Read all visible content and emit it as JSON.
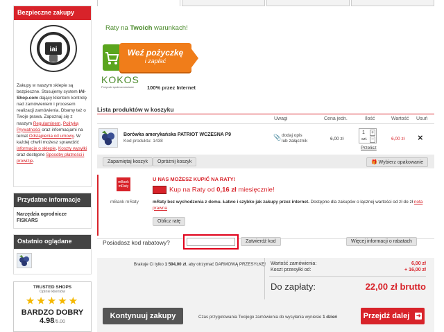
{
  "left": {
    "secure": {
      "heading": "Bezpieczne zakupy",
      "badge_ring": "POWERED BY IAI-Shop.com",
      "badge_logo": "iai",
      "text_1": "Zakupy w naszym sklepie są bezpieczne. Stosujemy system",
      "text_bold": "IAI-Shop.com",
      "text_2": "dający klientom kontrolę nad zamówieniem i procesem realizacji zamówienia. Dbamy też o Twoje prawa. Zapoznaj się z naszym",
      "link_regulations": "Regulaminem",
      "text_comma": ",",
      "link_privacy": "Polityką Prywatności",
      "text_3": "oraz informacjami na temat",
      "link_withdrawal": "Odstąpienia od umowy",
      "text_4": ". W każdej chwili możesz sprawdzić",
      "link_order_info": "informacje o sklepie",
      "text_5": ",",
      "link_shipping": "Koszty wysyłki",
      "text_6": "oraz dostępne",
      "link_payment": "Sposoby płatności i prowizje",
      "text_7": "."
    },
    "useful": {
      "heading": "Przydatne informacje",
      "line1": "Narzędzia ogrodnicze",
      "line2": "FISKARS"
    },
    "recent": {
      "heading": "Ostatnio oglądane"
    },
    "trusted": {
      "title": "TRUSTED SHOPS",
      "subtitle": "Opinie klientów",
      "rating_text": "BARDZO DOBRY",
      "score": "4.98",
      "score_max": "/5.00",
      "stars": 5
    }
  },
  "banner": {
    "tagline_1": "Raty na ",
    "tagline_bold": "Twoich",
    "tagline_2": " warunkach!",
    "button_line1": "Weź pożyczkę",
    "button_line2": "i zapłać",
    "brand": "KOKOS",
    "brand_sub": "Pożyczki społecznościowe",
    "internet": "100% przez Internet"
  },
  "cart": {
    "title": "Lista produktów w koszyku",
    "headers": {
      "notes": "Uwagi",
      "unit_price": "Cena jedn.",
      "quantity": "Ilość",
      "value": "Wartość",
      "remove": "Usuń"
    },
    "item": {
      "name": "Borówka amerykańska PATRIOT WCZESNA P9",
      "code_label": "Kod produktu:",
      "code": "1438",
      "note_line1": "dodaj opis",
      "note_line2": "lub załącznik",
      "price": "6,00 zł",
      "qty": "1",
      "unit": "szt.",
      "recalc": "Przelicz",
      "value": "6,00 zł",
      "remove": "×"
    },
    "btn_remember": "Zapamiętaj koszyk",
    "btn_clear": "Opróżnij koszyk",
    "btn_packaging": "Wybierz opakowanie"
  },
  "mbank": {
    "logo_top": "mBank",
    "logo_bottom": "mRaty",
    "label": "mBank mRaty",
    "title": "U NAS MOŻESZ KUPIĆ NA RATY!",
    "offer_1": "Kup na Raty od",
    "offer_amount": "0,16 zł",
    "offer_2": "miesięcznie!",
    "desc_bold": "mRaty bez wychodzenia z domu. Łatwo i szybko jak zakupy przez internet.",
    "desc": " Dostępne dla zakupów o łącznej wartości od zł do",
    "desc_link": "nota prawna",
    "desc_prefix": "zł",
    "btn": "Oblicz ratę"
  },
  "coupon": {
    "label": "Posiadasz kod rabatowy?",
    "value": "",
    "placeholder": "",
    "btn_confirm": "Zatwierdź kod",
    "btn_more": "Więcej informacji o rabatach"
  },
  "summary": {
    "free_shipping_1": "Brakuje Ci tylko",
    "free_shipping_amount": "1 594,00 zł",
    "free_shipping_2": ", aby otrzymać DARMOWĄ PRZESYŁKĘ!",
    "order_value_label": "Wartość zamówienia:",
    "order_value": "6,00 zł",
    "shipping_label": "Koszt przesyłki od:",
    "shipping_value": "+ 16,00 zł",
    "total_label": "Do zapłaty:",
    "total_value": "22,00 zł brutto"
  },
  "footer": {
    "btn_continue": "Kontynuuj zakupy",
    "prep_text_1": "Czas przygotowania Twojego zamówienia do wysyłania wyniesie",
    "prep_days": "1 dzień",
    "btn_next": "Przejdź dalej"
  },
  "colors": {
    "accent": "#d8232a",
    "orange": "#f07d1a",
    "green": "#5aa51e"
  }
}
